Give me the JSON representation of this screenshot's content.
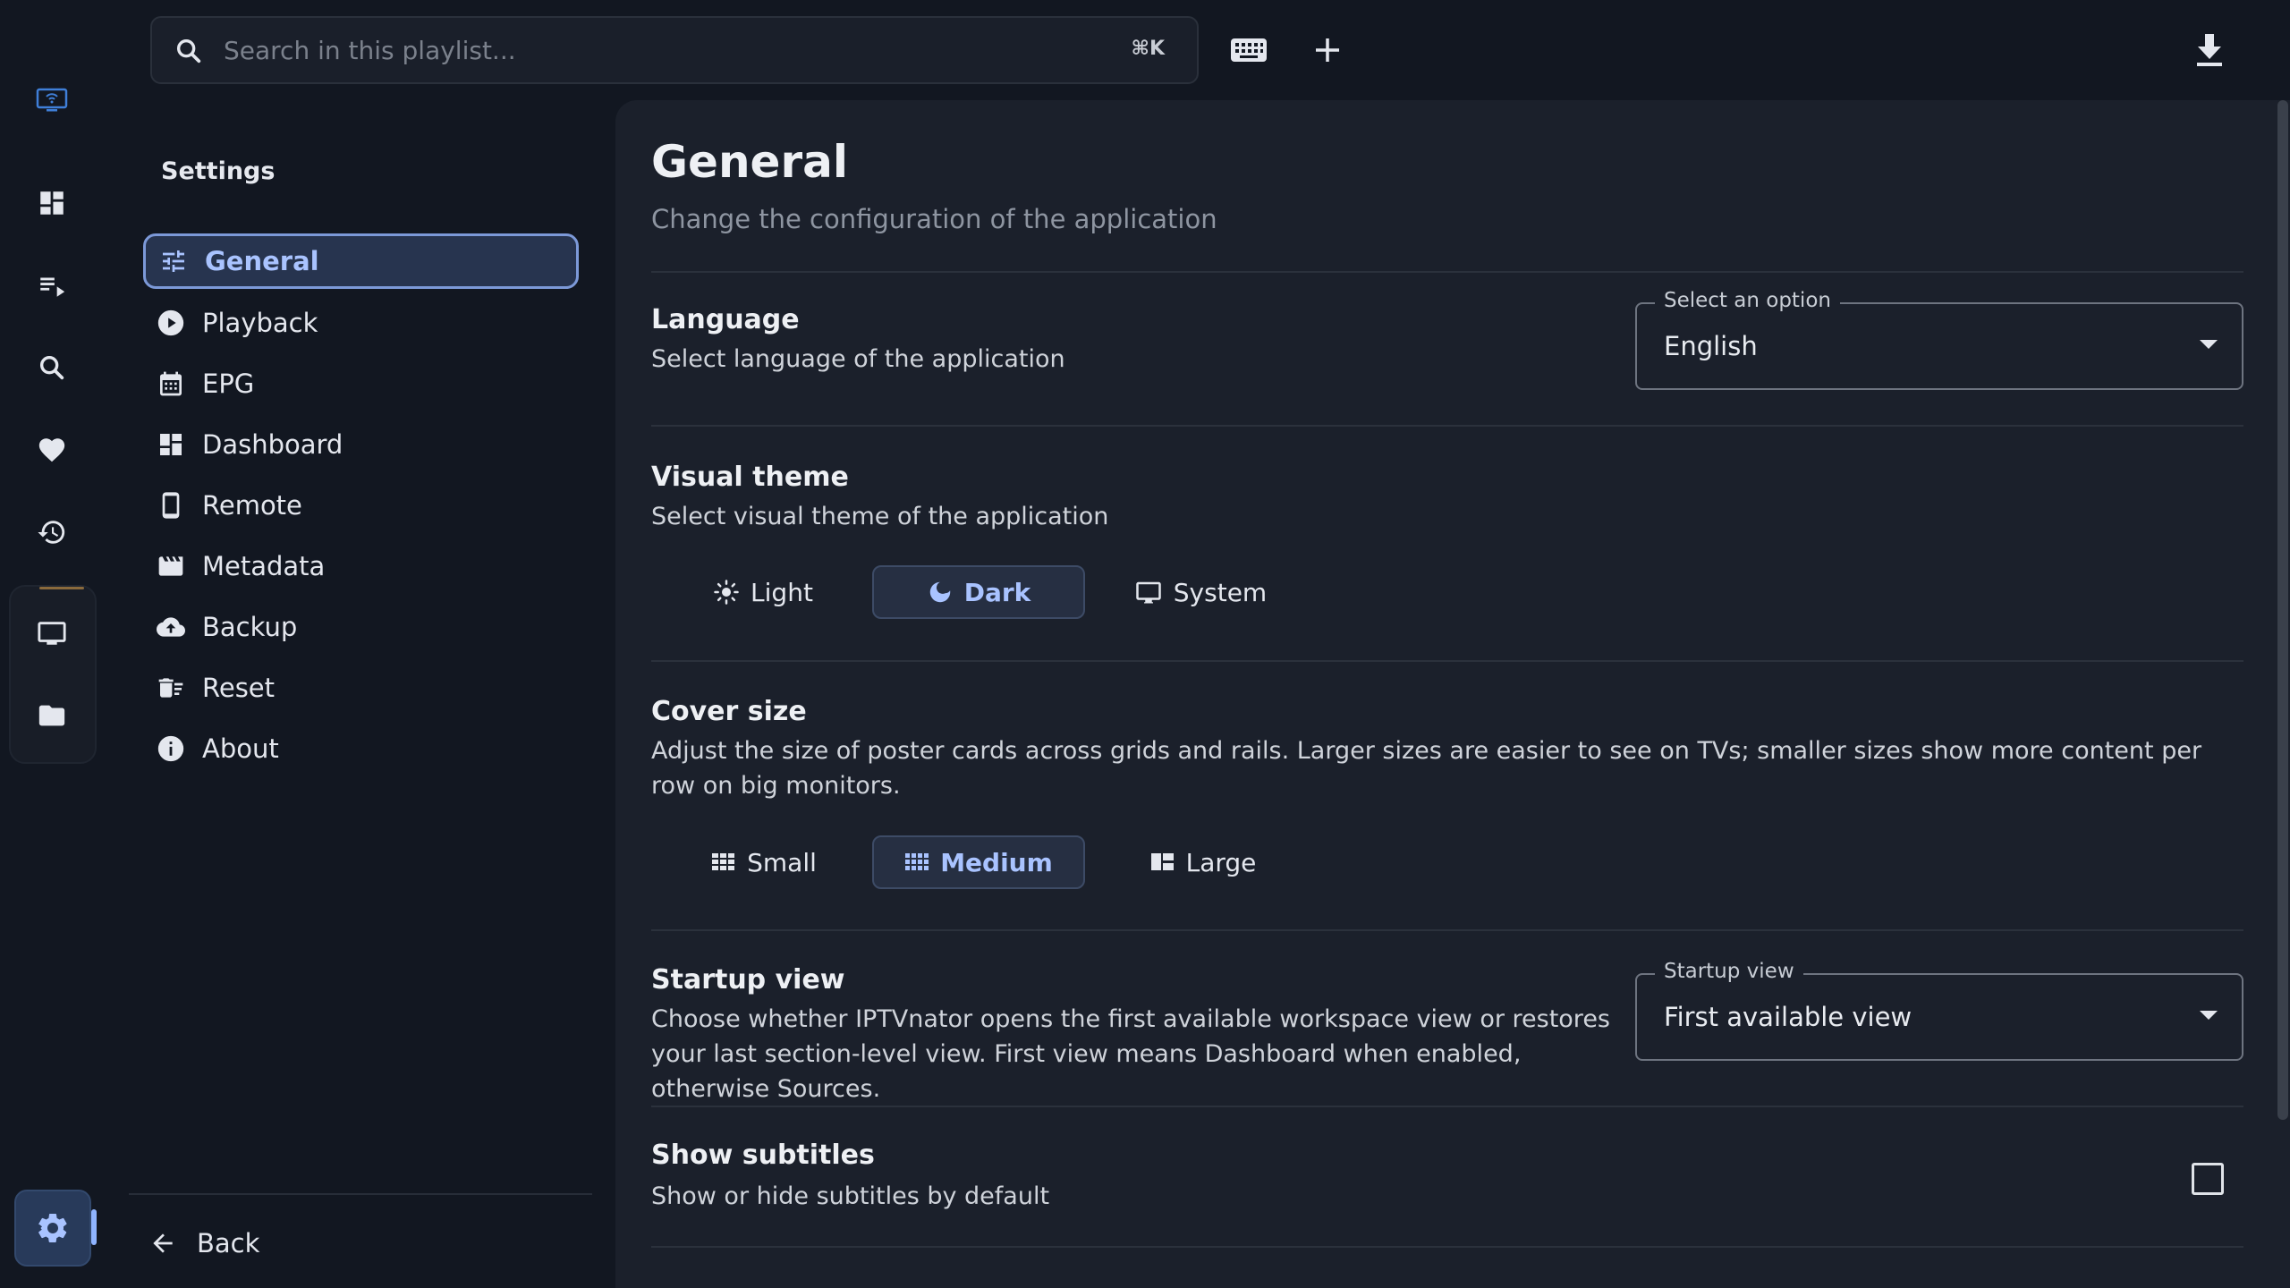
{
  "topbar": {
    "search_placeholder": "Search in this playlist...",
    "search_shortcut": "⌘K"
  },
  "settings_nav": {
    "heading": "Settings",
    "items": [
      {
        "label": "General",
        "icon": "tune-icon",
        "active": true
      },
      {
        "label": "Playback",
        "icon": "play-circle-icon"
      },
      {
        "label": "EPG",
        "icon": "calendar-icon"
      },
      {
        "label": "Dashboard",
        "icon": "dashboard-icon"
      },
      {
        "label": "Remote",
        "icon": "phone-icon"
      },
      {
        "label": "Metadata",
        "icon": "movie-icon"
      },
      {
        "label": "Backup",
        "icon": "cloud-upload-icon"
      },
      {
        "label": "Reset",
        "icon": "delete-sweep-icon"
      },
      {
        "label": "About",
        "icon": "info-icon"
      }
    ],
    "back_label": "Back"
  },
  "main": {
    "title": "General",
    "subtitle": "Change the configuration of the application",
    "language": {
      "title": "Language",
      "description": "Select language of the application",
      "select_label": "Select an option",
      "select_value": "English"
    },
    "visual_theme": {
      "title": "Visual theme",
      "description": "Select visual theme of the application",
      "options": [
        {
          "label": "Light",
          "icon": "sun-icon"
        },
        {
          "label": "Dark",
          "icon": "moon-icon",
          "selected": true
        },
        {
          "label": "System",
          "icon": "monitor-icon"
        }
      ]
    },
    "cover_size": {
      "title": "Cover size",
      "description": "Adjust the size of poster cards across grids and rails. Larger sizes are easier to see on TVs; smaller sizes show more content per row on big monitors.",
      "options": [
        {
          "label": "Small",
          "icon": "grid-small-icon"
        },
        {
          "label": "Medium",
          "icon": "grid-medium-icon",
          "selected": true
        },
        {
          "label": "Large",
          "icon": "grid-large-icon"
        }
      ]
    },
    "startup_view": {
      "title": "Startup view",
      "description": "Choose whether IPTVnator opens the first available workspace view or restores your last section-level view. First view means Dashboard when enabled, otherwise Sources.",
      "select_label": "Startup view",
      "select_value": "First available view"
    },
    "show_subtitles": {
      "title": "Show subtitles",
      "description": "Show or hide subtitles by default",
      "checked": false
    }
  },
  "colors": {
    "background": "#121721",
    "panel": "#1b202b",
    "accent": "#a9c3ff",
    "active_nav_bg": "#27344f"
  }
}
